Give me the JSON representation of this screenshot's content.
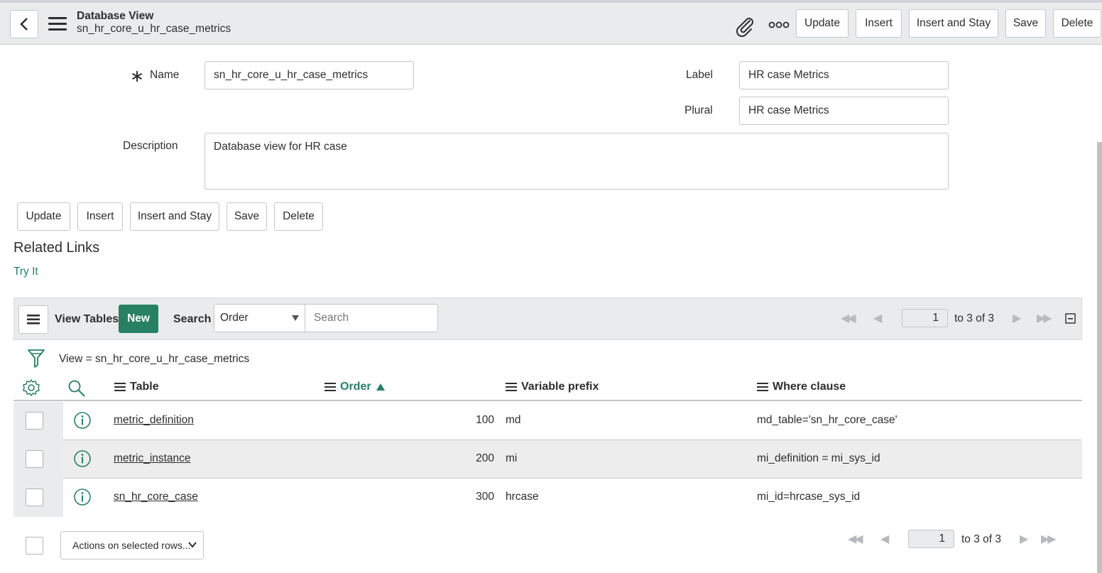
{
  "header": {
    "title": "Database View",
    "subtitle": "sn_hr_core_u_hr_case_metrics",
    "buttons": [
      "Update",
      "Insert",
      "Insert and Stay",
      "Save",
      "Delete"
    ],
    "icons": [
      "back-icon",
      "hamburger-icon",
      "paperclip-icon",
      "more-icon"
    ]
  },
  "form": {
    "name_label": "Name",
    "name_value": "sn_hr_core_u_hr_case_metrics",
    "label_label": "Label",
    "label_value": "HR case Metrics",
    "plural_label": "Plural",
    "plural_value": "HR case Metrics",
    "description_label": "Description",
    "description_value": "Database view  for HR case",
    "buttons": [
      "Update",
      "Insert",
      "Insert and Stay",
      "Save",
      "Delete"
    ]
  },
  "related": {
    "title": "Related Links",
    "link": "Try It"
  },
  "list": {
    "title": "View Tables",
    "new_label": "New",
    "search_label": "Search",
    "search_field": "Order",
    "search_placeholder": "Search",
    "page": "1",
    "range": "to 3 of 3",
    "filter": "View = sn_hr_core_u_hr_case_metrics",
    "columns": [
      "Table",
      "Order",
      "Variable prefix",
      "Where clause"
    ],
    "sort_column": "Order",
    "rows": [
      {
        "table": "metric_definition",
        "order": "100",
        "prefix": "md",
        "where": "md_table='sn_hr_core_case'"
      },
      {
        "table": "metric_instance",
        "order": "200",
        "prefix": "mi",
        "where": "mi_definition = mi_sys_id"
      },
      {
        "table": "sn_hr_core_case",
        "order": "300",
        "prefix": "hrcase",
        "where": "mi_id=hrcase_sys_id"
      }
    ],
    "actions_label": "Actions on selected rows...",
    "footer_page": "1",
    "footer_range": "to 3 of 3"
  },
  "colors": {
    "accent": "#278062",
    "header_bg": "#e9ebed",
    "border": "#c3c7cb"
  }
}
